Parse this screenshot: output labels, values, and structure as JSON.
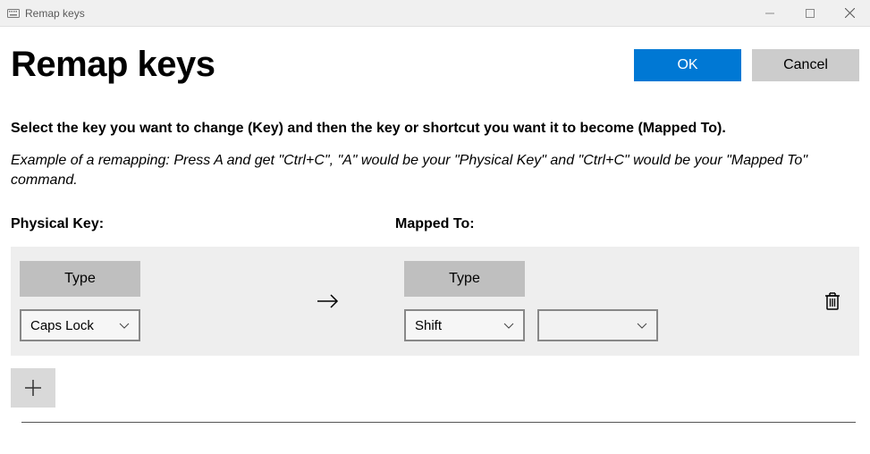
{
  "window": {
    "title": "Remap keys"
  },
  "header": {
    "title": "Remap keys",
    "ok": "OK",
    "cancel": "Cancel"
  },
  "instruction": "Select the key you want to change (Key) and then the key or shortcut you want it to become (Mapped To).",
  "example": "Example of a remapping: Press A and get \"Ctrl+C\", \"A\" would be your \"Physical Key\" and \"Ctrl+C\" would be your \"Mapped To\" command.",
  "columns": {
    "physical": "Physical Key:",
    "mapped": "Mapped To:"
  },
  "row": {
    "type_label": "Type",
    "physical_value": "Caps Lock",
    "mapped_value_1": "Shift",
    "mapped_value_2": ""
  },
  "add_label": "+"
}
